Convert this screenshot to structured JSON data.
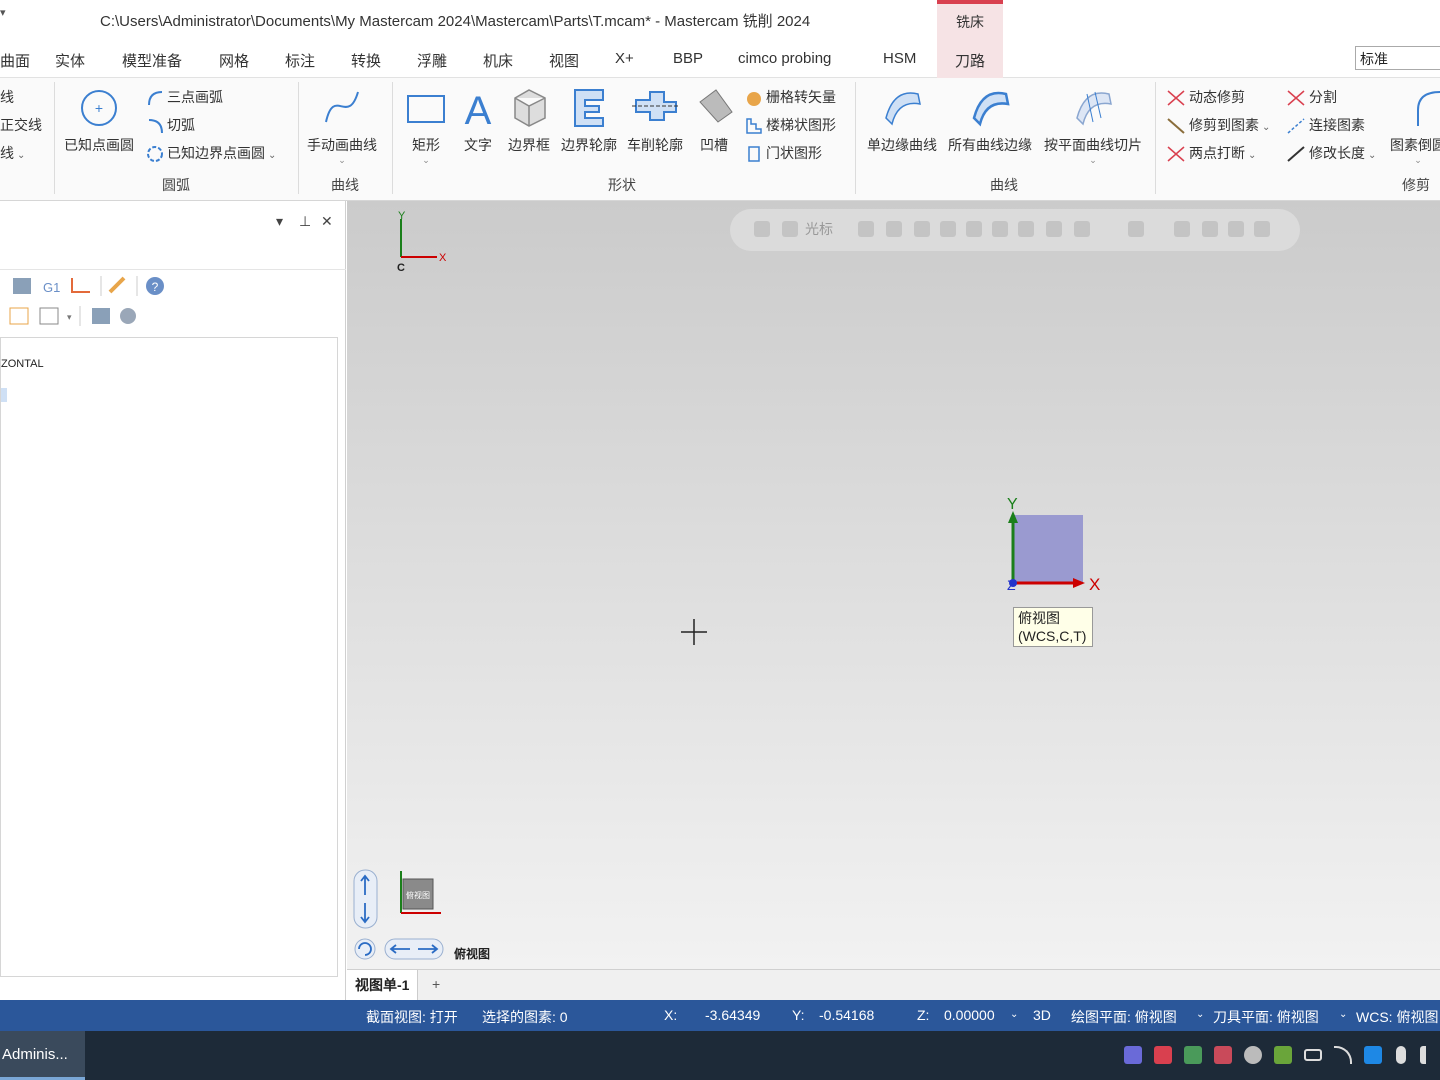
{
  "window": {
    "title": "C:\\Users\\Administrator\\Documents\\My Mastercam 2024\\Mastercam\\Parts\\T.mcam* - Mastercam 铣削 2024",
    "context_tab": "铣床"
  },
  "menu": {
    "tabs": [
      "曲面",
      "实体",
      "模型准备",
      "网格",
      "标注",
      "转换",
      "浮雕",
      "机床",
      "视图",
      "X+",
      "BBP",
      "cimco probing",
      "HSM"
    ],
    "active_context_tab": "刀路",
    "combo_value": "标准"
  },
  "ribbon": {
    "lines_partial": {
      "item1": "线",
      "item2": "正交线",
      "item3": "线"
    },
    "arcs": {
      "group_label": "圆弧",
      "big": "已知点画圆",
      "small": [
        "三点画弧",
        "切弧",
        "已知边界点画圆"
      ]
    },
    "curves_group": {
      "group_label": "曲线",
      "big": "手动画曲线"
    },
    "shapes": {
      "group_label": "形状",
      "big": [
        "矩形",
        "文字",
        "边界框",
        "边界轮廓",
        "车削轮廓",
        "凹槽"
      ],
      "small": [
        "栅格转矢量",
        "楼梯状图形",
        "门状图形"
      ]
    },
    "curves2": {
      "group_label": "曲线",
      "big": [
        "单边缘曲线",
        "所有曲线边缘",
        "按平面曲线切片"
      ]
    },
    "trim": {
      "group_label": "修剪",
      "small": [
        "动态修剪",
        "修剪到图素",
        "两点打断",
        "分割",
        "连接图素",
        "修改长度"
      ],
      "big": "图素倒圆"
    }
  },
  "left_panel": {
    "tree_node": "ZONTAL"
  },
  "viewport": {
    "toolbar_label": "光标",
    "axis_labels": {
      "x": "X",
      "y": "Y",
      "c": "C",
      "z": "Z"
    },
    "tooltip_line1": "俯视图",
    "tooltip_line2": "(WCS,C,T)",
    "view_name": "俯视图",
    "cube_label": "俯视图",
    "gizmo_color": "#9a9ad0"
  },
  "view_tabs": {
    "active": "视图单-1",
    "add": "+"
  },
  "status": {
    "section_view": "截面视图: 打开",
    "selected": "选择的图素: 0",
    "x_label": "X:",
    "x_value": "-3.64349",
    "y_label": "Y:",
    "y_value": "-0.54168",
    "z_label": "Z:",
    "z_value": "0.00000",
    "mode": "3D",
    "gplane": "绘图平面: 俯视图",
    "tplane": "刀具平面: 俯视图",
    "wcs": "WCS: 俯视图"
  },
  "taskbar": {
    "task_label": "Adminis..."
  },
  "colors": {
    "status_bg": "#2b579a",
    "context_accent": "#d9404f",
    "taskbar_bg": "#1d2a38"
  }
}
